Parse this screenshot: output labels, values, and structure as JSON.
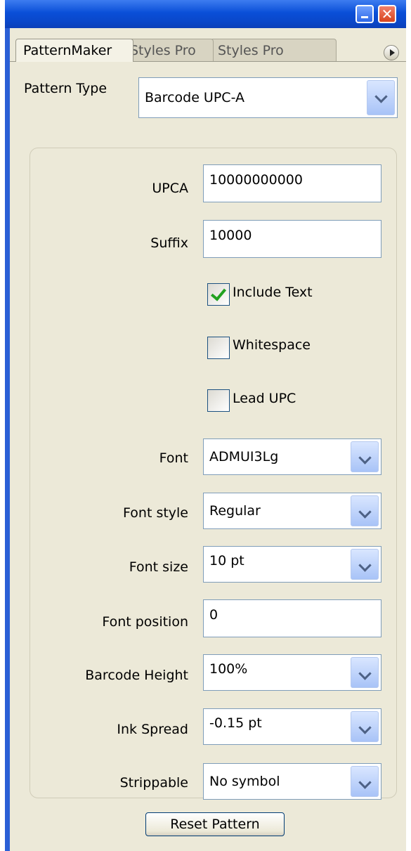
{
  "tabs": [
    {
      "label": "PatternMaker"
    },
    {
      "label": "Styles Pro"
    },
    {
      "label": "Styles Pro"
    }
  ],
  "pattern_type": {
    "label": "Pattern Type",
    "value": "Barcode UPC-A"
  },
  "fields": {
    "upca": {
      "label": "UPCA",
      "value": "10000000000"
    },
    "suffix": {
      "label": "Suffix",
      "value": "10000"
    },
    "include_text": {
      "label": "Include Text",
      "checked": true
    },
    "whitespace": {
      "label": "Whitespace",
      "checked": false
    },
    "lead_upc": {
      "label": "Lead UPC",
      "checked": false
    },
    "font": {
      "label": "Font",
      "value": "ADMUI3Lg"
    },
    "font_style": {
      "label": "Font style",
      "value": "Regular"
    },
    "font_size": {
      "label": "Font size",
      "value": "10 pt"
    },
    "font_position": {
      "label": "Font position",
      "value": "0"
    },
    "barcode_height": {
      "label": "Barcode Height",
      "value": "100%"
    },
    "ink_spread": {
      "label": "Ink Spread",
      "value": "-0.15 pt"
    },
    "strippable": {
      "label": "Strippable",
      "value": "No symbol"
    }
  },
  "reset_button": {
    "label": "Reset Pattern"
  },
  "title_buttons": {
    "minimize": "minimize-icon",
    "close": "close-icon"
  }
}
